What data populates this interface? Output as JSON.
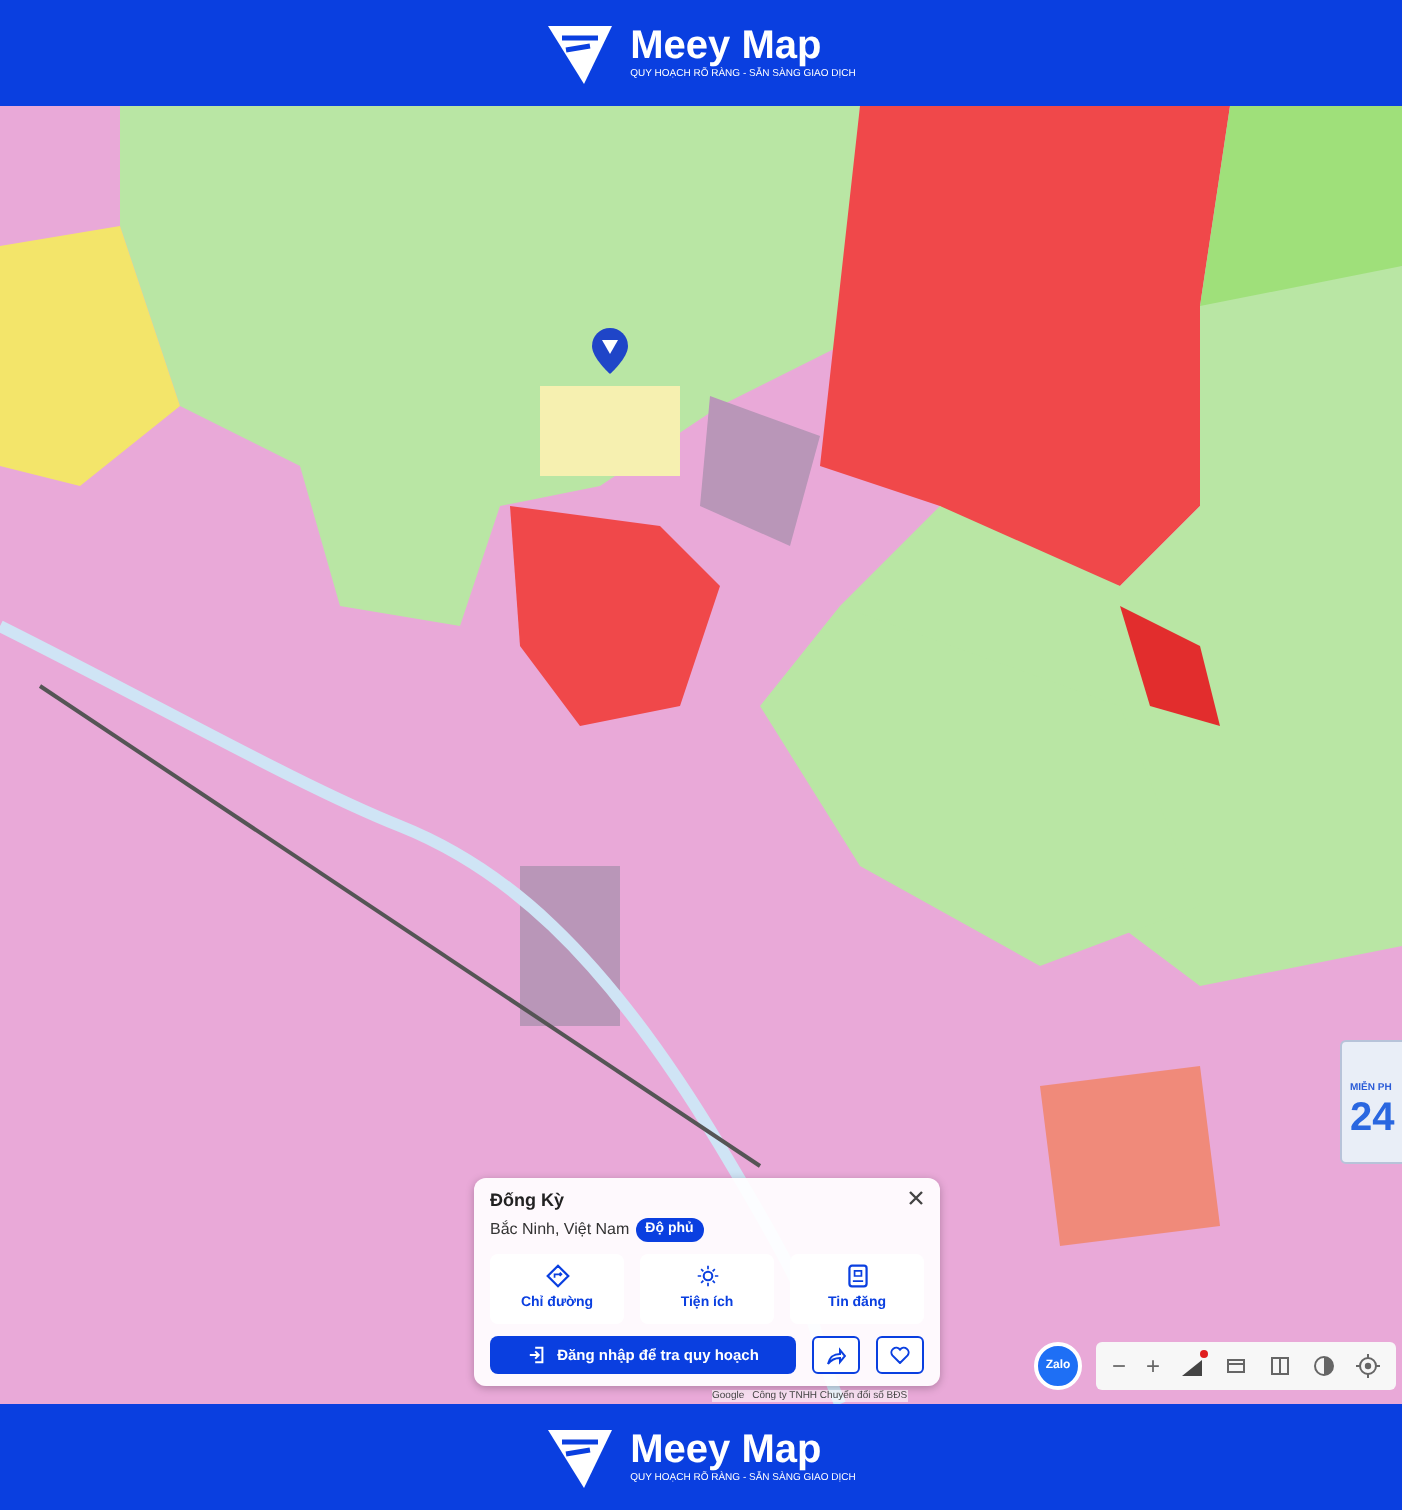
{
  "header": {
    "brand": "Meey Map",
    "tagline": "QUY HOẠCH RÕ RÀNG - SẴN SÀNG GIAO DỊCH"
  },
  "map": {
    "attribution": [
      "Google",
      "Công ty TNHH Chuyển đổi số BĐS"
    ]
  },
  "place_card": {
    "title": "Đống Kỳ",
    "subtitle": "Bắc Ninh, Việt Nam",
    "badge": "Độ phủ",
    "actions": [
      {
        "label": "Chỉ đường",
        "kind": "directions"
      },
      {
        "label": "Tiện ích",
        "kind": "amenities"
      },
      {
        "label": "Tin đăng",
        "kind": "listings"
      }
    ],
    "login_button": "Đăng nhập để tra quy hoạch"
  },
  "zalo": "Zalo",
  "toolbar": [
    {
      "kind": "zoom_out",
      "label": "−"
    },
    {
      "kind": "zoom_in",
      "label": "+"
    },
    {
      "kind": "layers",
      "notification": true
    },
    {
      "kind": "panel"
    },
    {
      "kind": "split"
    },
    {
      "kind": "opacity"
    },
    {
      "kind": "locate"
    }
  ],
  "promo": {
    "label": "MIỄN PH",
    "value": "24"
  },
  "footer": {
    "brand": "Meey Map",
    "tagline": "QUY HOẠCH RÕ RÀNG - SẴN SÀNG GIAO DỊCH"
  }
}
